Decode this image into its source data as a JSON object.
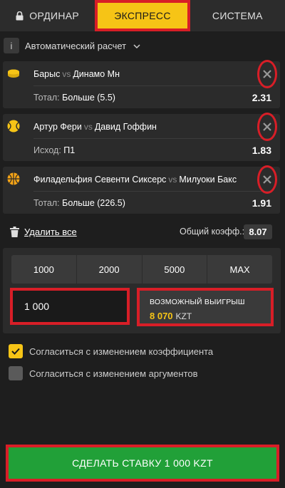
{
  "tabs": [
    {
      "label": "ОРДИНАР"
    },
    {
      "label": "ЭКСПРЕСС"
    },
    {
      "label": "СИСТЕМА"
    }
  ],
  "calc": {
    "info": "i",
    "label": "Автоматический расчет"
  },
  "bets": [
    {
      "sport_icon": "hockey-puck-icon",
      "team1": "Барыс",
      "vs": "vs",
      "team2": "Динамо Мн",
      "market_label": "Тотал:",
      "market_value": "Больше (5.5)",
      "odds": "2.31"
    },
    {
      "sport_icon": "tennis-ball-icon",
      "team1": "Артур Фери",
      "vs": "vs",
      "team2": "Давид Гоффин",
      "market_label": "Исход:",
      "market_value": "П1",
      "odds": "1.83"
    },
    {
      "sport_icon": "basketball-icon",
      "team1": "Филадельфия Севенти Сиксерс",
      "vs": "vs",
      "team2": "Милуоки Бакс",
      "market_label": "Тотал:",
      "market_value": "Больше (226.5)",
      "odds": "1.91"
    }
  ],
  "summary": {
    "delete_all": "Удалить все",
    "total_label": "Общий коэфф.:",
    "total_value": "8.07"
  },
  "quick_amounts": [
    "1000",
    "2000",
    "5000",
    "MAX"
  ],
  "stake": {
    "value": "1 000"
  },
  "possible_win": {
    "label": "ВОЗМОЖНЫЙ ВЫИГРЫШ",
    "value": "8 070",
    "currency": "KZT"
  },
  "options": [
    {
      "label": "Согласиться с изменением коэффициента",
      "checked": true
    },
    {
      "label": "Согласиться с изменением аргументов",
      "checked": false
    }
  ],
  "submit": {
    "label": "СДЕЛАТЬ СТАВКУ 1 000 KZT"
  },
  "colors": {
    "accent": "#f6c416",
    "highlight": "#d81e27",
    "submit": "#21a038",
    "background": "#1e1e1e"
  }
}
